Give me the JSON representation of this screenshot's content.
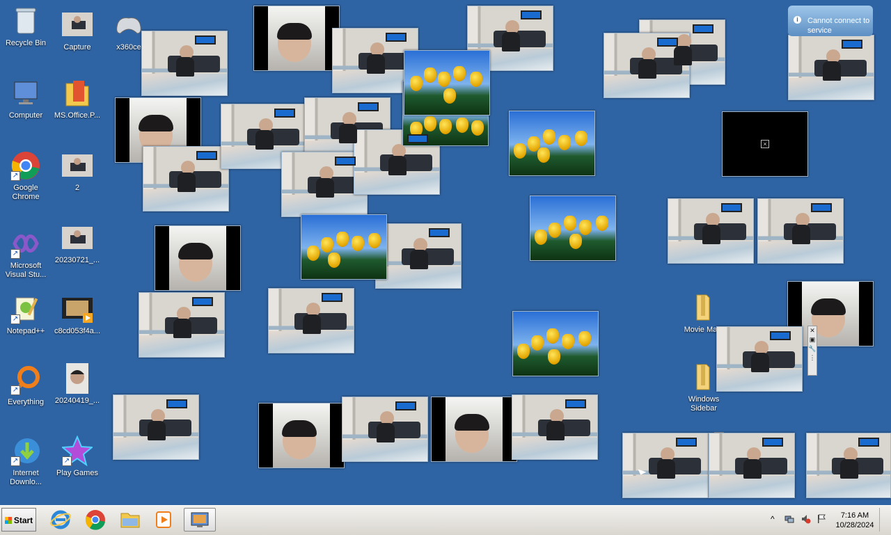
{
  "desktop": {
    "icons": [
      {
        "label": "Recycle Bin",
        "icon": "recycle-bin-icon"
      },
      {
        "label": "Capture",
        "icon": "image-file-icon"
      },
      {
        "label": "x360ce",
        "icon": "gamepad-icon"
      },
      {
        "label": "Computer",
        "icon": "computer-icon"
      },
      {
        "label": "MS.Office.P...",
        "icon": "folder-icon"
      },
      {
        "label": "Google Chrome",
        "icon": "chrome-icon"
      },
      {
        "label": "2",
        "icon": "image-file-icon"
      },
      {
        "label": "Microsoft Visual Stu...",
        "icon": "visual-studio-icon"
      },
      {
        "label": "20230721_...",
        "icon": "image-file-icon"
      },
      {
        "label": "Notepad++",
        "icon": "notepad-plus-plus-icon"
      },
      {
        "label": "c8cd053f4a...",
        "icon": "video-file-icon"
      },
      {
        "label": "Everything",
        "icon": "everything-search-icon"
      },
      {
        "label": "20240419_...",
        "icon": "image-file-icon"
      },
      {
        "label": "Internet Downlo...",
        "icon": "internet-download-manager-icon"
      },
      {
        "label": "Play Games",
        "icon": "play-games-icon"
      },
      {
        "label": "Movie Ma...",
        "icon": "folder-icon"
      },
      {
        "label": "Windows Sidebar",
        "icon": "folder-icon"
      }
    ]
  },
  "gadget_error": {
    "message": "Cannot connect to service"
  },
  "taskbar": {
    "start_label": "Start",
    "pinned": [
      "internet-explorer-icon",
      "chrome-icon",
      "file-explorer-icon",
      "media-player-icon",
      "slideshow-gadget-icon"
    ],
    "tray": {
      "time": "7:16 AM",
      "date": "10/28/2024"
    }
  }
}
